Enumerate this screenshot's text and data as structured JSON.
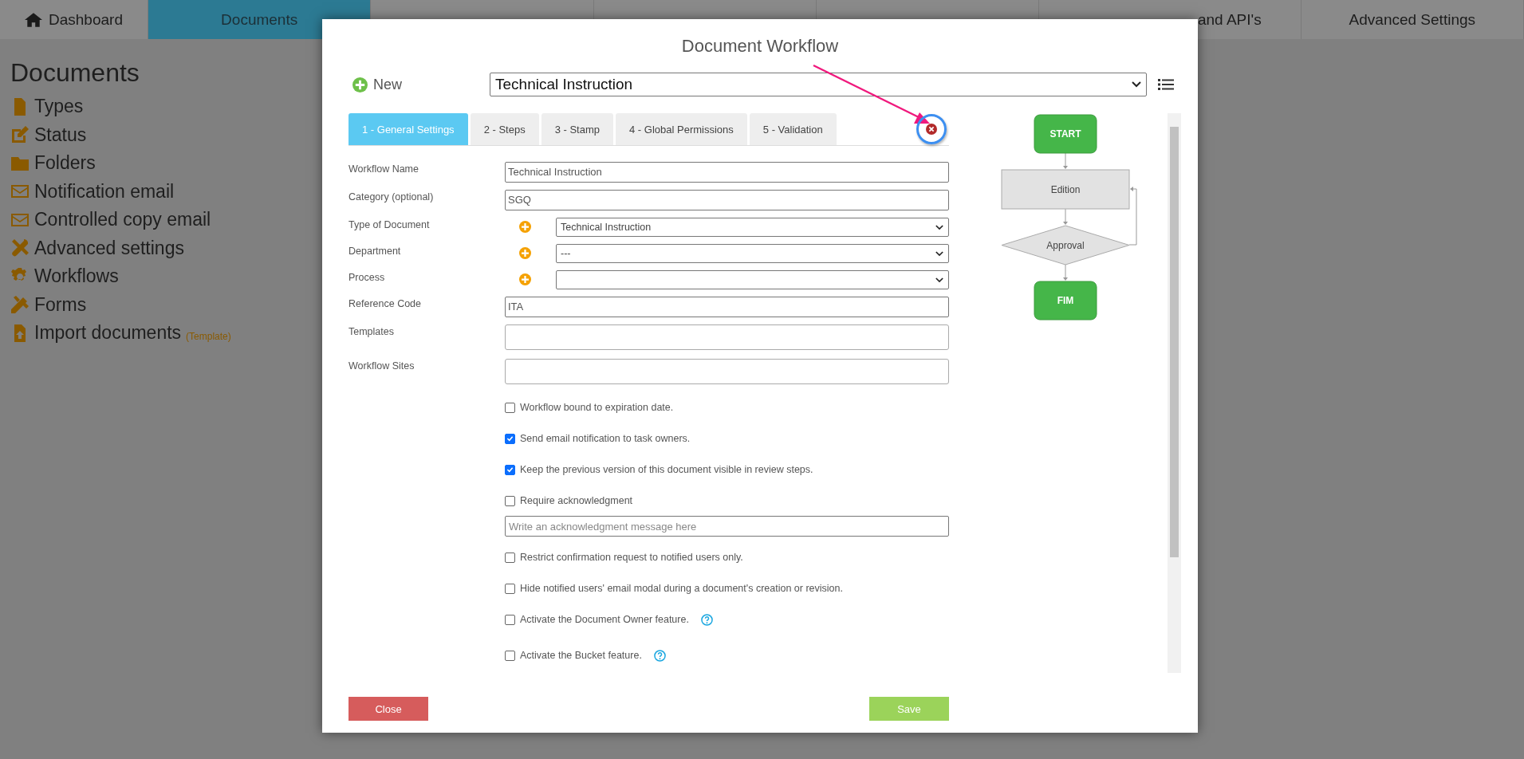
{
  "nav_tabs": [
    {
      "label": "Dashboard",
      "selected": false
    },
    {
      "label": "Documents",
      "selected": true
    },
    {
      "selected": false
    },
    {
      "selected": false
    },
    {
      "selected": false
    },
    {
      "label": "and API's",
      "selected": false
    },
    {
      "label": "Advanced Settings",
      "selected": false
    }
  ],
  "sidebar": {
    "title": "Documents",
    "items": [
      {
        "label": "Types"
      },
      {
        "label": "Status"
      },
      {
        "label": "Folders"
      },
      {
        "label": "Notification email"
      },
      {
        "label": "Controlled copy email"
      },
      {
        "label": "Advanced settings"
      },
      {
        "label": "Workflows"
      },
      {
        "label": "Forms"
      },
      {
        "label": "Import documents",
        "note": "(Template)"
      }
    ]
  },
  "modal": {
    "title": "Document Workflow",
    "new_label": "New",
    "workflow_select": "Technical Instruction",
    "tabs": [
      {
        "label": "1 - General Settings",
        "selected": true
      },
      {
        "label": "2 - Steps",
        "selected": false
      },
      {
        "label": "3 - Stamp",
        "selected": false
      },
      {
        "label": "4 - Global Permissions",
        "selected": false
      },
      {
        "label": "5 - Validation",
        "selected": false
      }
    ],
    "fields": [
      {
        "label": "Workflow Name",
        "kind": "text",
        "value": "Technical Instruction"
      },
      {
        "label": "Category (optional)",
        "kind": "text",
        "value": "SGQ"
      },
      {
        "label": "Type of Document",
        "kind": "select",
        "value": "Technical Instruction"
      },
      {
        "label": "Department",
        "kind": "select",
        "value": "---"
      },
      {
        "label": "Process",
        "kind": "select"
      },
      {
        "label": "Reference Code",
        "kind": "text",
        "value": "ITA"
      },
      {
        "label": "Templates",
        "kind": "multi"
      },
      {
        "label": "Workflow Sites",
        "kind": "multi"
      }
    ],
    "options": [
      {
        "kind": "checkbox",
        "label": "Workflow bound to expiration date.",
        "checked": false,
        "help": false
      },
      {
        "kind": "checkbox",
        "label": "Send email notification to task owners.",
        "checked": true,
        "help": false
      },
      {
        "kind": "checkbox",
        "label": "Keep the previous version of this document visible in review steps.",
        "checked": true,
        "help": false
      },
      {
        "kind": "checkbox",
        "label": "Require acknowledgment",
        "checked": false,
        "help": false
      },
      {
        "kind": "input",
        "placeholder": "Write an acknowledgment message here"
      },
      {
        "kind": "checkbox",
        "label": "Restrict confirmation request to notified users only.",
        "checked": false,
        "help": false
      },
      {
        "kind": "checkbox",
        "label": "Hide notified users' email modal during a document's creation or revision.",
        "checked": false,
        "help": false
      },
      {
        "kind": "checkbox",
        "label": "Activate the Document Owner feature.",
        "checked": false,
        "help": true
      },
      {
        "kind": "checkbox",
        "label": "Activate the Bucket feature.",
        "checked": false,
        "help": true
      }
    ],
    "flowchart": {
      "nodes": [
        {
          "kind": "terminal",
          "label": "START"
        },
        {
          "kind": "step",
          "label": "Edition"
        },
        {
          "kind": "decision",
          "label": "Approval"
        },
        {
          "kind": "terminal",
          "label": "FIM"
        }
      ]
    },
    "buttons": {
      "close": "Close",
      "save": "Save"
    }
  }
}
